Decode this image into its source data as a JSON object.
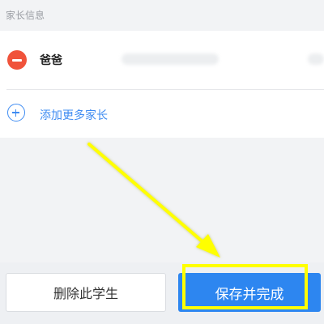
{
  "section": {
    "title": "家长信息"
  },
  "parents": [
    {
      "label": "爸爸"
    }
  ],
  "add_parent": {
    "label": "添加更多家长"
  },
  "actions": {
    "delete_label": "删除此学生",
    "save_label": "保存并完成"
  },
  "annotation": {
    "color": "#ffff00"
  },
  "colors": {
    "primary": "#2d86f0",
    "danger": "#f0533b",
    "link": "#3f8cf2"
  }
}
